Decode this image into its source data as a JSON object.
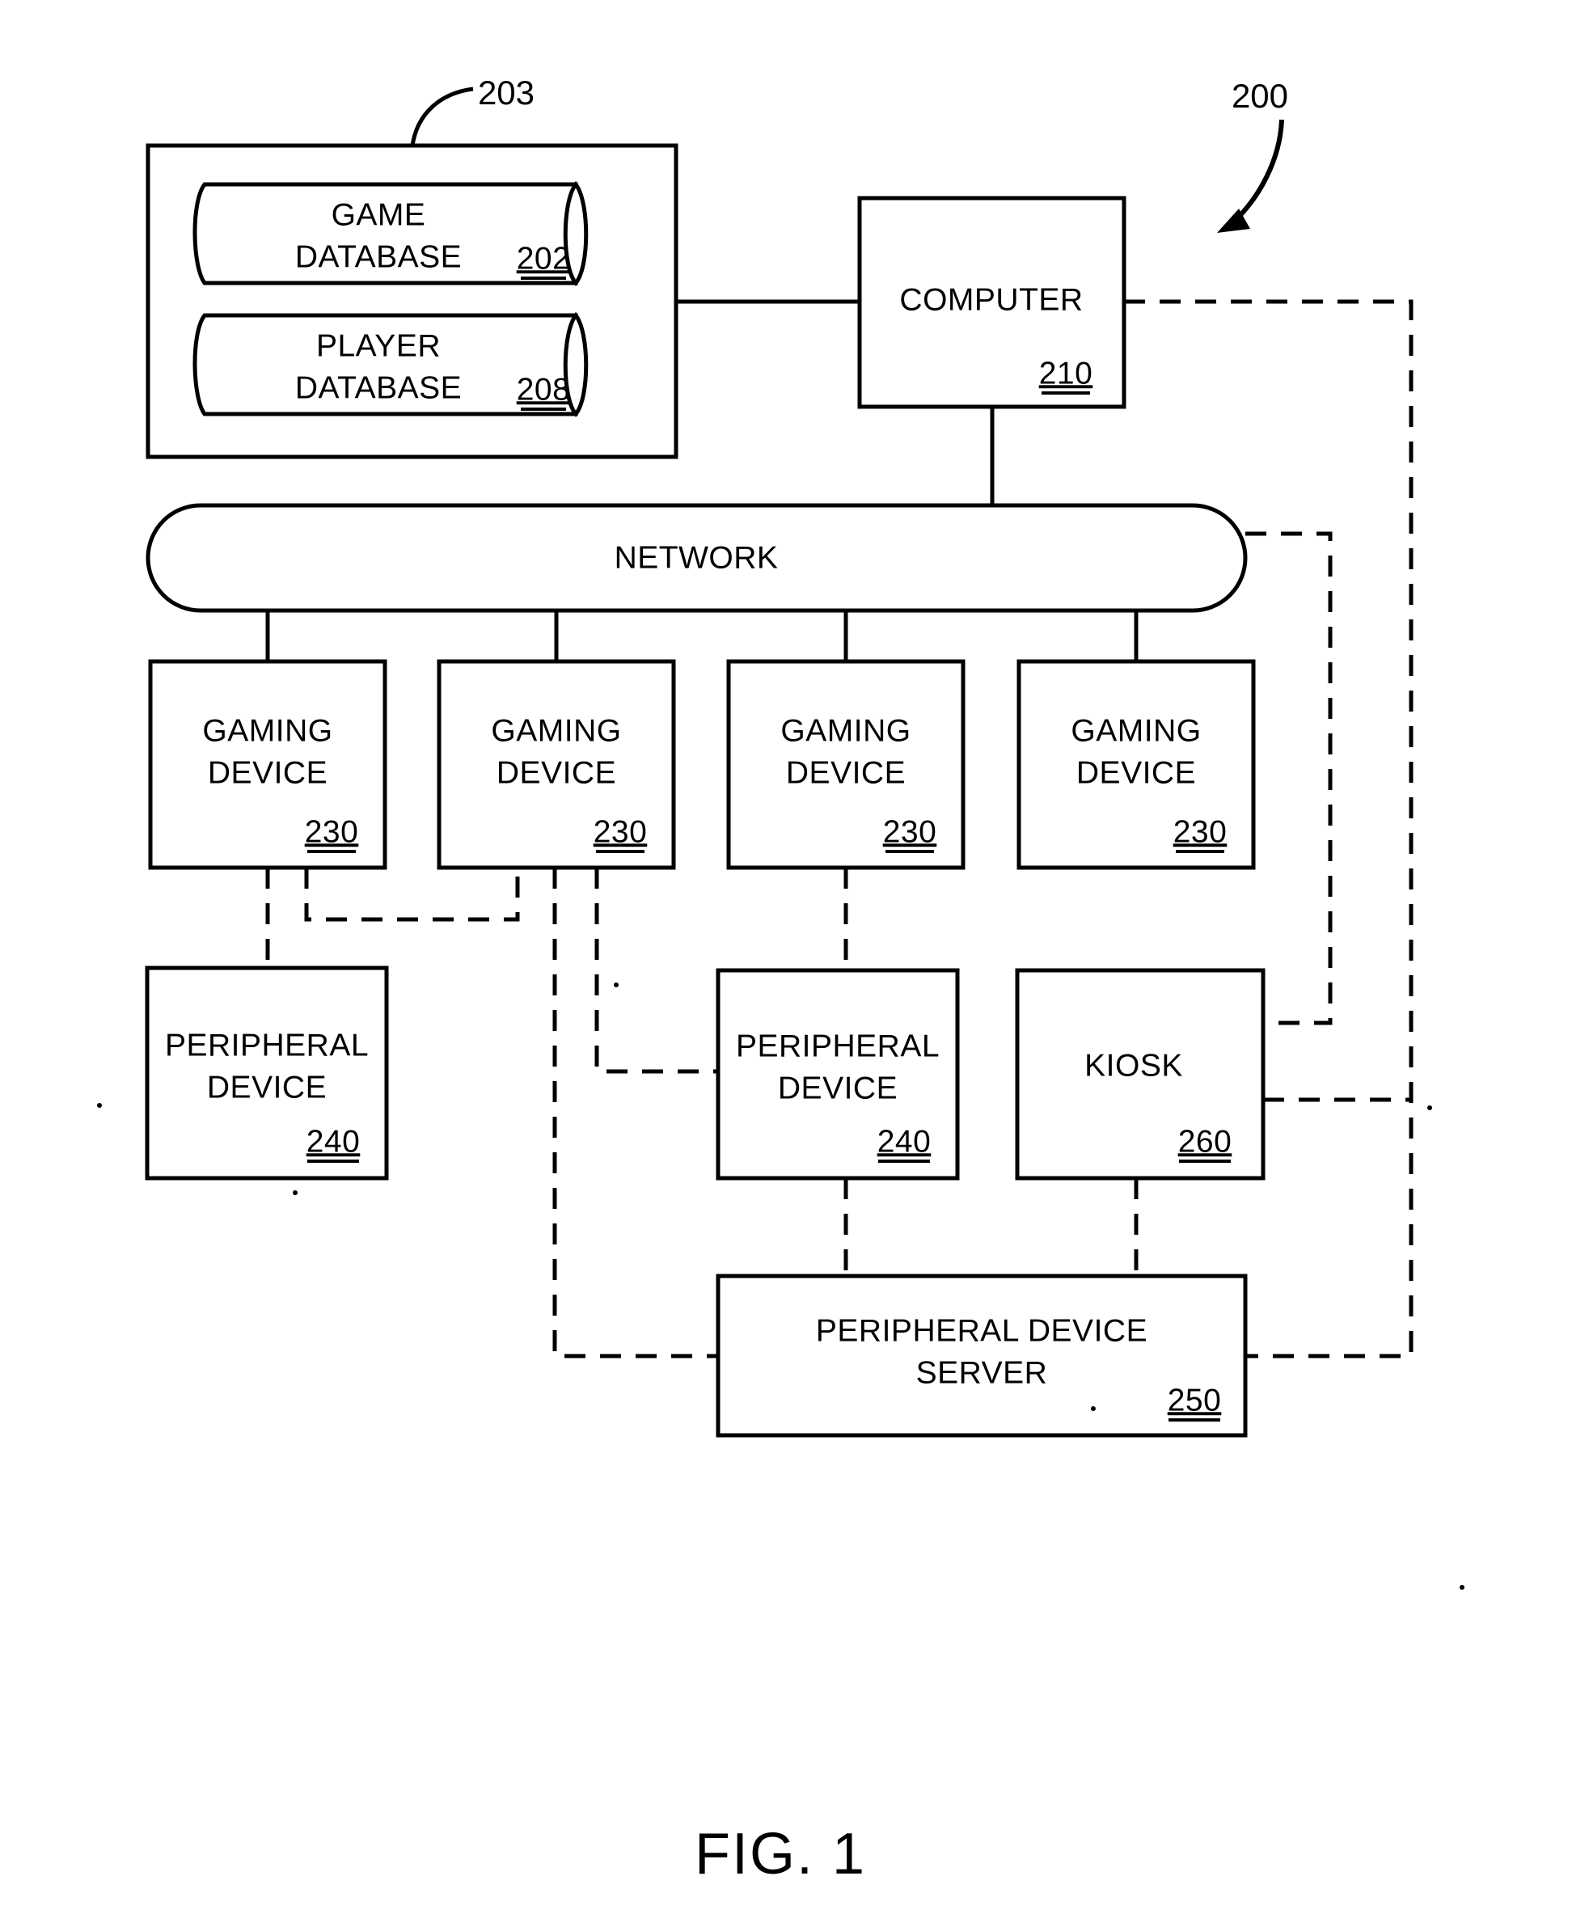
{
  "figure": {
    "caption": "FIG. 1",
    "system_callout": "200",
    "group_callout": "203"
  },
  "nodes": {
    "game_database": {
      "line1": "GAME",
      "line2": "DATABASE",
      "ref": "202"
    },
    "player_database": {
      "line1": "PLAYER",
      "line2": "DATABASE",
      "ref": "208"
    },
    "computer": {
      "line1": "COMPUTER",
      "ref": "210"
    },
    "network": {
      "line1": "NETWORK"
    },
    "gaming_device_1": {
      "line1": "GAMING",
      "line2": "DEVICE",
      "ref": "230"
    },
    "gaming_device_2": {
      "line1": "GAMING",
      "line2": "DEVICE",
      "ref": "230"
    },
    "gaming_device_3": {
      "line1": "GAMING",
      "line2": "DEVICE",
      "ref": "230"
    },
    "gaming_device_4": {
      "line1": "GAMING",
      "line2": "DEVICE",
      "ref": "230"
    },
    "peripheral_device_1": {
      "line1": "PERIPHERAL",
      "line2": "DEVICE",
      "ref": "240"
    },
    "peripheral_device_2": {
      "line1": "PERIPHERAL",
      "line2": "DEVICE",
      "ref": "240"
    },
    "kiosk": {
      "line1": "KIOSK",
      "ref": "260"
    },
    "peripheral_device_server": {
      "line1": "PERIPHERAL DEVICE",
      "line2": "SERVER",
      "ref": "250"
    }
  },
  "colors": {
    "ink": "#000000",
    "paper": "#ffffff"
  }
}
